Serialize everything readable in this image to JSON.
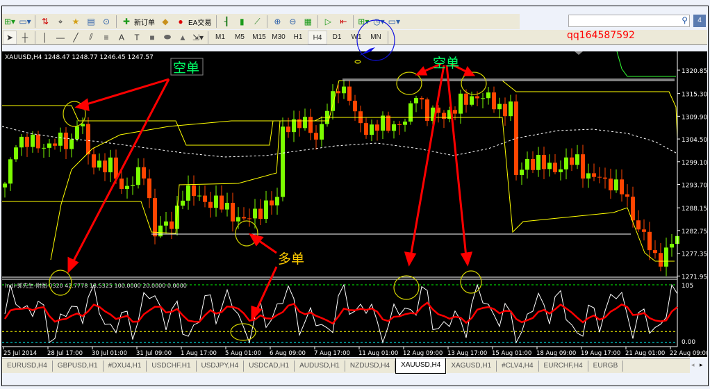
{
  "toolbar": {
    "new_order": "新订单",
    "ea_trading": "EA交易",
    "search_icon": "magnifier-icon",
    "notification_count": "4"
  },
  "timeframes": [
    "M1",
    "M5",
    "M15",
    "M30",
    "H1",
    "H4",
    "D1",
    "W1",
    "MN"
  ],
  "active_timeframe": "H4",
  "watermark": "qq164587592",
  "chart": {
    "header": "XAUUSD,H4  1248.47 1248.77 1246.45 1247.57",
    "indicator_header": "Indi-郭先生-附图-0320 42.7778 13.5325 100.0000 20.0000 0.0000",
    "price_ticks": [
      "1320.85",
      "1315.30",
      "1309.90",
      "1304.50",
      "1299.10",
      "1293.70",
      "1288.15",
      "1282.75",
      "1277.35",
      "1271.95"
    ],
    "indicator_ticks": [
      "105",
      "0.00"
    ],
    "time_ticks": [
      "25 Jul 2014",
      "28 Jul 17:00",
      "30 Jul 01:00",
      "31 Jul 09:00",
      "1 Aug 17:00",
      "5 Aug 01:00",
      "6 Aug 09:00",
      "7 Aug 17:00",
      "11 Aug 01:00",
      "12 Aug 09:00",
      "13 Aug 17:00",
      "15 Aug 01:00",
      "18 Aug 09:00",
      "19 Aug 17:00",
      "21 Aug 01:00",
      "22 Aug 09:00"
    ],
    "annotations": {
      "short1": "空单",
      "short2": "空单",
      "long": "多单"
    },
    "colors": {
      "bull": "#7cfc00",
      "bear": "#ff4500",
      "band": "#ffff00",
      "signal": "#ff0000"
    },
    "price_path": [
      [
        0,
        1293
      ],
      [
        2,
        1304.5
      ],
      [
        6,
        1303
      ],
      [
        12,
        1304
      ],
      [
        13.5,
        1311
      ],
      [
        15,
        1299.6
      ],
      [
        19,
        1297.9
      ],
      [
        21,
        1292.9
      ],
      [
        25,
        1296.3
      ],
      [
        27,
        1283.1
      ],
      [
        30,
        1283.9
      ],
      [
        32,
        1292.1
      ],
      [
        37,
        1289.6
      ],
      [
        40,
        1288
      ],
      [
        43,
        1284.7
      ],
      [
        46,
        1288
      ],
      [
        49,
        1289.6
      ],
      [
        50,
        1307.8
      ],
      [
        55,
        1307.8
      ],
      [
        56,
        1304.5
      ],
      [
        58,
        1311
      ],
      [
        60,
        1317.7
      ],
      [
        62,
        1314.4
      ],
      [
        63,
        1309.5
      ],
      [
        65,
        1307
      ],
      [
        70,
        1308.1
      ],
      [
        72.5,
        1308.6
      ],
      [
        74,
        1316.1
      ],
      [
        76,
        1310.3
      ],
      [
        79,
        1310.3
      ],
      [
        82,
        1312.8
      ],
      [
        85,
        1315.2
      ],
      [
        89,
        1312
      ],
      [
        91,
        1312
      ],
      [
        92,
        1295.4
      ],
      [
        94,
        1299.6
      ],
      [
        97,
        1298
      ],
      [
        100,
        1297.9
      ],
      [
        103,
        1299.6
      ],
      [
        105,
        1295.4
      ],
      [
        109,
        1294.5
      ],
      [
        111,
        1292
      ],
      [
        113,
        1286.4
      ],
      [
        115,
        1281.4
      ],
      [
        117,
        1275.6
      ],
      [
        118,
        1276.5
      ],
      [
        120,
        1279.8
      ],
      [
        121,
        1280.6
      ]
    ]
  },
  "tabs": [
    "EURUSD,H4",
    "GBPUSD,H1",
    "#DXU4,H1",
    "USDCHF,H1",
    "USDJPY,H4",
    "USDCAD,H1",
    "AUDUSD,H1",
    "NZDUSD,H4",
    "XAUUSD,H4",
    "XAGUSD,H1",
    "#CLV4,H4",
    "EURCHF,H4",
    "EURGB"
  ],
  "active_tab": "XAUUSD,H4"
}
